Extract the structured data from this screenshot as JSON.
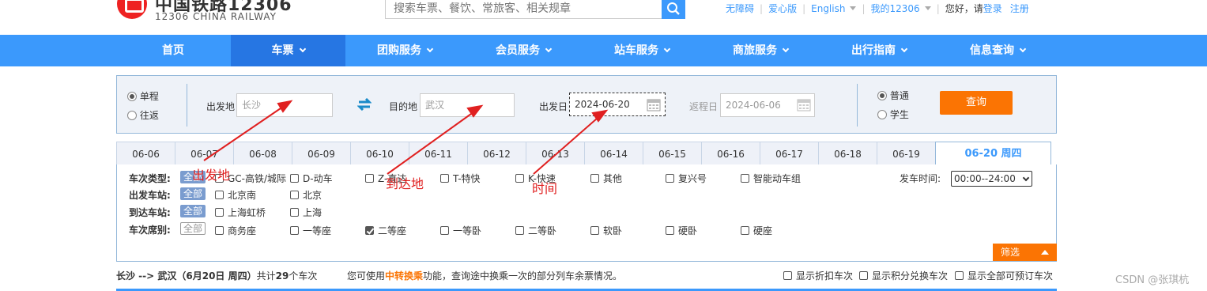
{
  "header": {
    "logo_cn": "中国铁路12306",
    "logo_en": "12306 CHINA RAILWAY",
    "search_placeholder": "搜索车票、餐饮、常旅客、相关规章",
    "links": {
      "accessible": "无障碍",
      "care": "爱心版",
      "english": "English",
      "my12306": "我的12306",
      "hello": "您好，请",
      "login": "登录",
      "register": "注册"
    }
  },
  "nav": {
    "items": [
      {
        "label": "首页",
        "caret": false
      },
      {
        "label": "车票",
        "caret": true,
        "active": true
      },
      {
        "label": "团购服务",
        "caret": true
      },
      {
        "label": "会员服务",
        "caret": true
      },
      {
        "label": "站车服务",
        "caret": true
      },
      {
        "label": "商旅服务",
        "caret": true
      },
      {
        "label": "出行指南",
        "caret": true
      },
      {
        "label": "信息查询",
        "caret": true
      }
    ]
  },
  "query": {
    "trip_oneway": "单程",
    "trip_round": "往返",
    "from_label": "出发地",
    "from_value": "长沙",
    "to_label": "目的地",
    "to_value": "武汉",
    "date_label": "出发日",
    "date_value": "2024-06-20",
    "return_label": "返程日",
    "return_value": "2024-06-06",
    "type_normal": "普通",
    "type_student": "学生",
    "search_button": "查询"
  },
  "date_tabs": [
    "06-06",
    "06-07",
    "06-08",
    "06-09",
    "06-10",
    "06-11",
    "06-12",
    "06-13",
    "06-14",
    "06-15",
    "06-16",
    "06-17",
    "06-18",
    "06-19",
    "06-20 周四"
  ],
  "filters": {
    "all_label": "全部",
    "train_type_label": "车次类型:",
    "train_types": [
      "GC-高铁/城际",
      "D-动车",
      "Z-直达",
      "T-特快",
      "K-快速",
      "其他",
      "复兴号",
      "智能动车组"
    ],
    "depart_time_label": "发车时间:",
    "depart_time_value": "00:00--24:00",
    "from_station_label": "出发车站:",
    "from_stations": [
      "北京南",
      "北京"
    ],
    "to_station_label": "到达车站:",
    "to_stations": [
      "上海虹桥",
      "上海"
    ],
    "seat_label": "车次席别:",
    "seats": [
      "商务座",
      "一等座",
      "二等座",
      "一等卧",
      "二等卧",
      "软卧",
      "硬卧",
      "硬座"
    ],
    "seat_checked": "二等座",
    "filter_button": "筛选"
  },
  "summary": {
    "route": "长沙 --> 武汉（6月20日  周四）",
    "count_prefix": "共计",
    "count": "29",
    "count_suffix": "个车次",
    "tip_prefix": "您可使用",
    "tip_highlight": "中转换乘",
    "tip_suffix": "功能，查询途中换乘一次的部分列车余票情况。",
    "opt_discount": "显示折扣车次",
    "opt_points": "显示积分兑换车次",
    "opt_all": "显示全部可预订车次"
  },
  "annotations": {
    "from": "出发地",
    "to": "到达地",
    "time": "时间"
  },
  "watermark": "CSDN @张琪杭",
  "colors": {
    "primary": "#3b99fc",
    "nav_active": "#2676e3",
    "orange": "#fb7403",
    "annotation": "#e02020"
  }
}
